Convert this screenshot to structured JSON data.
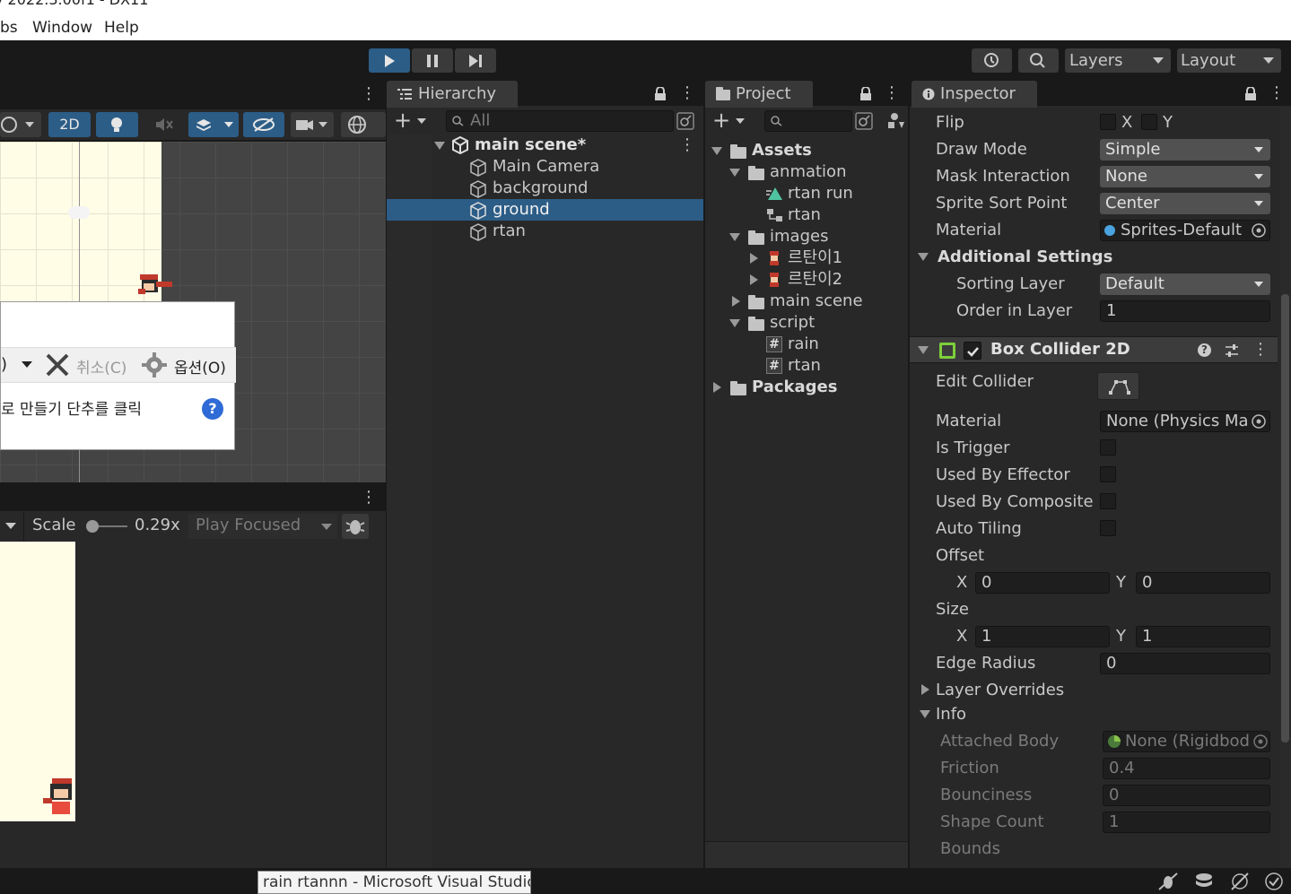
{
  "window": {
    "title_partial": "y 2022.3.00f1 - DX11"
  },
  "menu": {
    "items": [
      "bs",
      "Window",
      "Help"
    ]
  },
  "toolbar": {
    "layers_label": "Layers",
    "layout_label": "Layout"
  },
  "scene": {
    "mode_2d": "2D"
  },
  "game": {
    "scale_label": "Scale",
    "scale_value": "0.29x",
    "play_mode": "Play Focused"
  },
  "dialog": {
    "cancel_label": "취소(C)",
    "options_label": "옵션(O)",
    "prefix_label": ")",
    "hint_text": "로 만들기 단추를 클릭"
  },
  "hierarchy": {
    "tab": "Hierarchy",
    "search_placeholder": "All",
    "scene_name": "main scene*",
    "items": [
      "Main Camera",
      "background",
      "ground",
      "rtan"
    ],
    "selected": "ground"
  },
  "project": {
    "tab": "Project",
    "tree": {
      "assets": "Assets",
      "anmation": "anmation",
      "rtan_run": "rtan run",
      "rtan_anim": "rtan",
      "images": "images",
      "img1": "르탄이1",
      "img2": "르탄이2",
      "main_scene": "main scene",
      "script": "script",
      "rain": "rain",
      "rtan_script": "rtan",
      "packages": "Packages"
    }
  },
  "inspector": {
    "tab": "Inspector",
    "flip_label": "Flip",
    "flip_x": "X",
    "flip_y": "Y",
    "draw_mode_label": "Draw Mode",
    "draw_mode": "Simple",
    "mask_label": "Mask Interaction",
    "mask": "None",
    "sort_point_label": "Sprite Sort Point",
    "sort_point": "Center",
    "material_label": "Material",
    "material": "Sprites-Default",
    "additional_settings": "Additional Settings",
    "sorting_layer_label": "Sorting Layer",
    "sorting_layer": "Default",
    "order_label": "Order in Layer",
    "order": "1",
    "box_collider": "Box Collider 2D",
    "edit_collider_label": "Edit Collider",
    "bc_material_label": "Material",
    "bc_material": "None (Physics Ma",
    "is_trigger": "Is Trigger",
    "used_by_effector": "Used By Effector",
    "used_by_composite": "Used By Composite",
    "auto_tiling": "Auto Tiling",
    "offset_label": "Offset",
    "offset_x_label": "X",
    "offset_x": "0",
    "offset_y_label": "Y",
    "offset_y": "0",
    "size_label": "Size",
    "size_x_label": "X",
    "size_x": "1",
    "size_y_label": "Y",
    "size_y": "1",
    "edge_radius_label": "Edge Radius",
    "edge_radius": "0",
    "layer_overrides": "Layer Overrides",
    "info": "Info",
    "attached_body_label": "Attached Body",
    "attached_body": "None (Rigidbod",
    "friction_label": "Friction",
    "friction": "0.4",
    "bounciness_label": "Bounciness",
    "bounciness": "0",
    "shape_count_label": "Shape Count",
    "shape_count": "1",
    "bounds_label": "Bounds"
  },
  "taskbar": {
    "tooltip": "rain rtannn - Microsoft Visual Studio"
  }
}
